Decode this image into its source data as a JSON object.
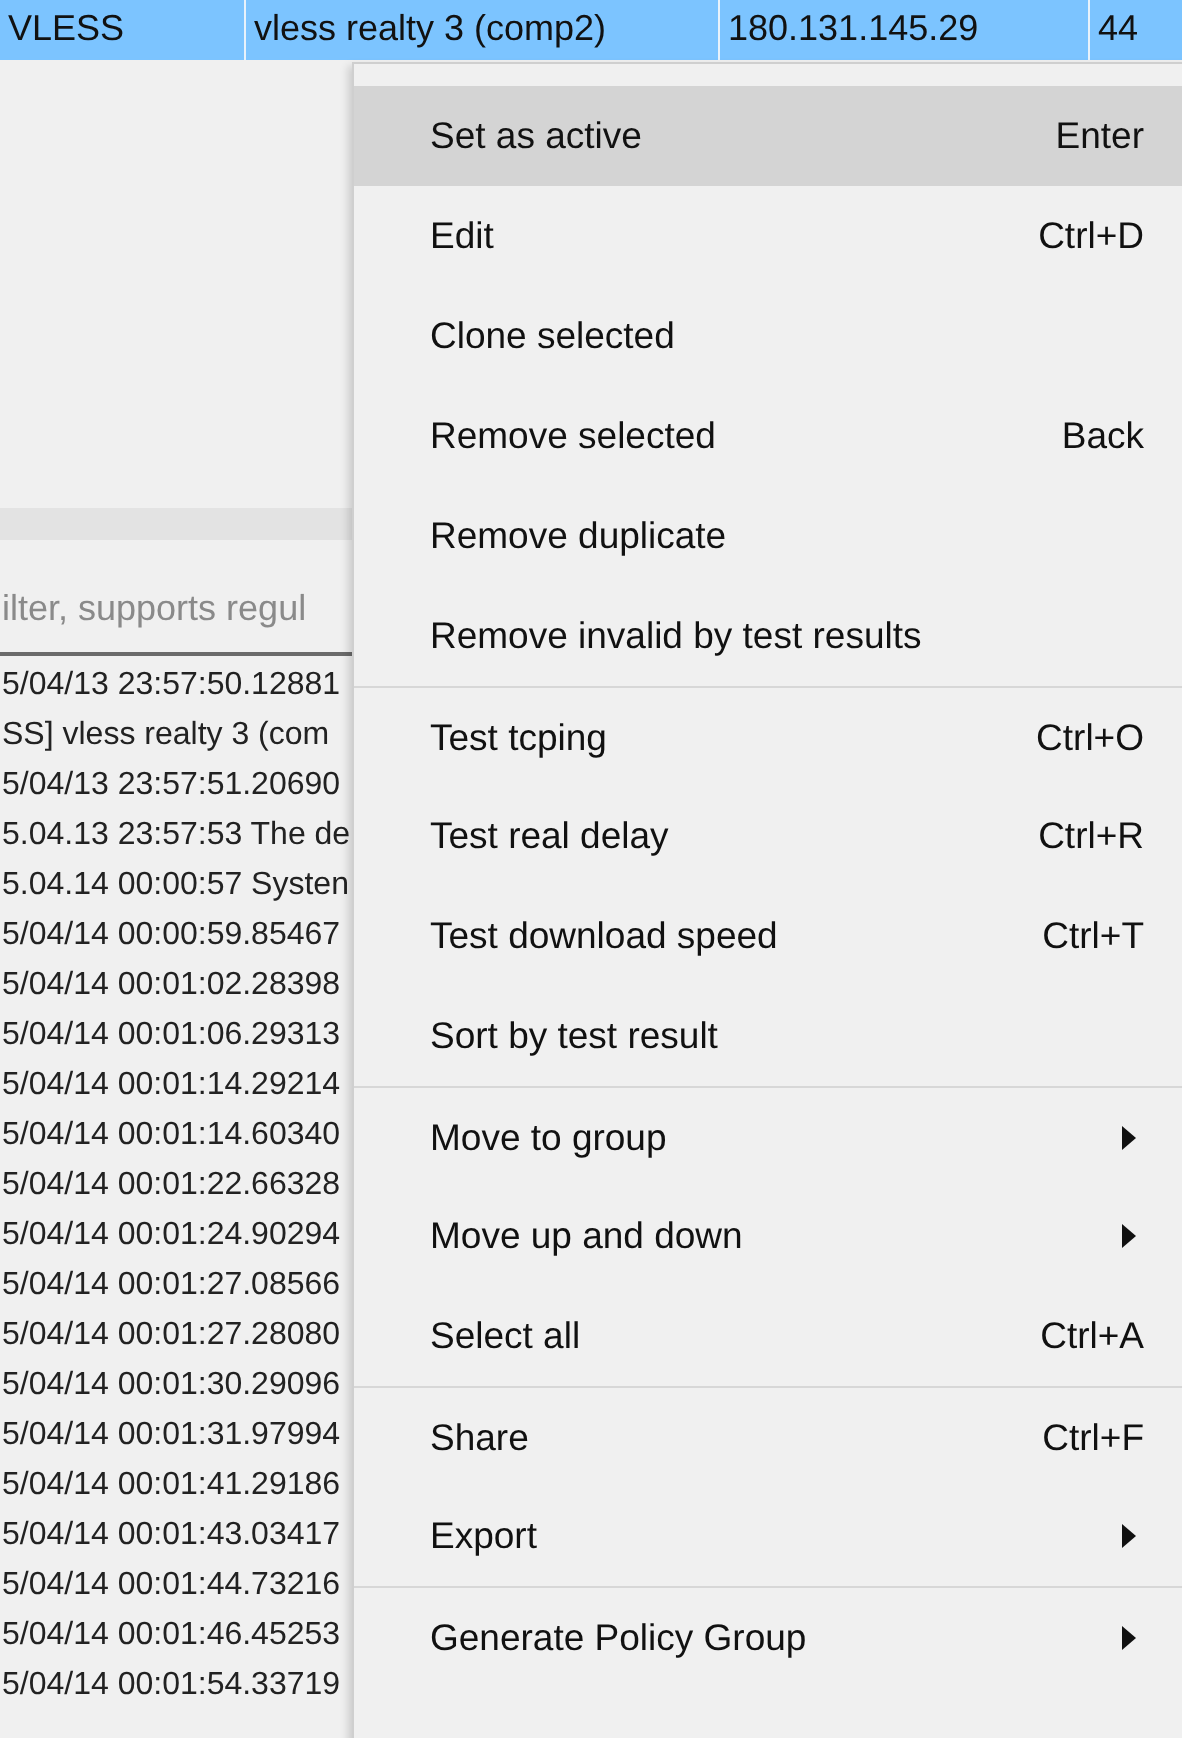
{
  "table": {
    "selected_row": {
      "selected": true,
      "cells": [
        "VLESS",
        "vless realty 3 (comp2)",
        "180.131.145.29",
        "44"
      ]
    }
  },
  "filter": {
    "placeholder": "ilter, supports regul"
  },
  "log_lines": [
    "5/04/13 23:57:50.12881",
    "SS] vless realty 3 (com",
    "5/04/13 23:57:51.20690",
    "5.04.13 23:57:53 The de",
    "5.04.14 00:00:57 Systen",
    "5/04/14 00:00:59.85467",
    "5/04/14 00:01:02.28398",
    "5/04/14 00:01:06.29313",
    "5/04/14 00:01:14.29214",
    "5/04/14 00:01:14.60340",
    "5/04/14 00:01:22.66328",
    "5/04/14 00:01:24.90294",
    "5/04/14 00:01:27.08566",
    "5/04/14 00:01:27.28080",
    "5/04/14 00:01:30.29096",
    "5/04/14 00:01:31.97994",
    "5/04/14 00:01:41.29186",
    "5/04/14 00:01:43.03417",
    "5/04/14 00:01:44.73216",
    "5/04/14 00:01:46.45253",
    "5/04/14 00:01:54.33719"
  ],
  "context_menu": {
    "items": [
      {
        "label": "Set as active",
        "shortcut": "Enter",
        "selected": true,
        "submenu": false,
        "separator_before": false
      },
      {
        "label": "Edit",
        "shortcut": "Ctrl+D",
        "selected": false,
        "submenu": false,
        "separator_before": false
      },
      {
        "label": "Clone selected",
        "selected": false,
        "submenu": false,
        "separator_before": false
      },
      {
        "label": "Remove selected",
        "shortcut": "Back",
        "selected": false,
        "submenu": false,
        "separator_before": false
      },
      {
        "label": "Remove duplicate",
        "selected": false,
        "submenu": false,
        "separator_before": false
      },
      {
        "label": "Remove invalid by test results",
        "selected": false,
        "submenu": false,
        "separator_before": false
      },
      {
        "label": "Test tcping",
        "shortcut": "Ctrl+O",
        "selected": false,
        "submenu": false,
        "separator_before": true
      },
      {
        "label": "Test real delay",
        "shortcut": "Ctrl+R",
        "selected": false,
        "submenu": false,
        "separator_before": false
      },
      {
        "label": "Test download speed",
        "shortcut": "Ctrl+T",
        "selected": false,
        "submenu": false,
        "separator_before": false
      },
      {
        "label": "Sort by test result",
        "selected": false,
        "submenu": false,
        "separator_before": false
      },
      {
        "label": "Move to group",
        "selected": false,
        "submenu": true,
        "separator_before": true
      },
      {
        "label": "Move up and down",
        "selected": false,
        "submenu": true,
        "separator_before": false
      },
      {
        "label": "Select all",
        "shortcut": "Ctrl+A",
        "selected": false,
        "submenu": false,
        "separator_before": false
      },
      {
        "label": "Share",
        "shortcut": "Ctrl+F",
        "selected": false,
        "submenu": false,
        "separator_before": true
      },
      {
        "label": "Export",
        "selected": false,
        "submenu": true,
        "separator_before": false
      },
      {
        "label": "Generate Policy Group",
        "selected": false,
        "submenu": true,
        "separator_before": true
      }
    ]
  }
}
